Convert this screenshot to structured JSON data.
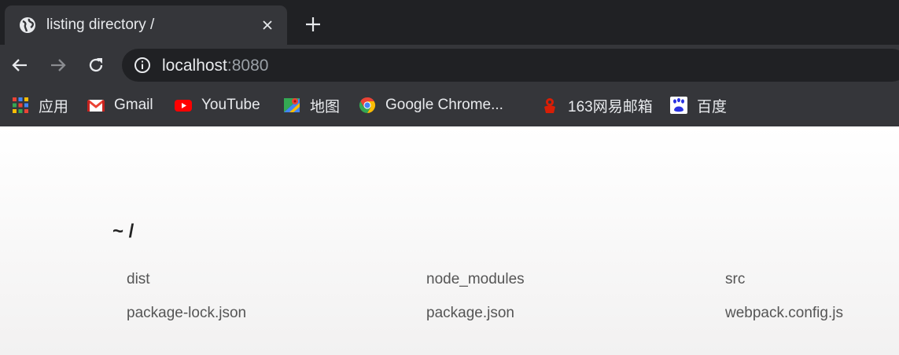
{
  "tab": {
    "title": "listing directory /",
    "close_symbol": "×",
    "favicon": "globe-icon"
  },
  "new_tab_symbol": "+",
  "toolbar": {
    "back_icon": "arrow-left-icon",
    "forward_icon": "arrow-right-icon",
    "reload_icon": "reload-icon",
    "url_host": "localhost",
    "url_port": ":8080"
  },
  "bookmarks": [
    {
      "label": "应用",
      "icon": "apps-grid-icon"
    },
    {
      "label": "Gmail",
      "icon": "gmail-icon"
    },
    {
      "label": "YouTube",
      "icon": "youtube-icon"
    },
    {
      "label": "地图",
      "icon": "maps-icon"
    },
    {
      "label": "Google Chrome...",
      "icon": "chrome-icon"
    },
    {
      "label": "163网易邮箱",
      "icon": "netease-163-icon"
    },
    {
      "label": "百度",
      "icon": "baidu-icon"
    }
  ],
  "page": {
    "heading": "~ /",
    "files": [
      {
        "name": "dist"
      },
      {
        "name": "node_modules"
      },
      {
        "name": "src"
      },
      {
        "name": "package-lock.json"
      },
      {
        "name": "package.json"
      },
      {
        "name": "webpack.config.js"
      }
    ]
  },
  "colors": {
    "frame": "#202124",
    "toolbar": "#35363a",
    "text_light": "#e8eaed",
    "file_text": "#555555"
  }
}
